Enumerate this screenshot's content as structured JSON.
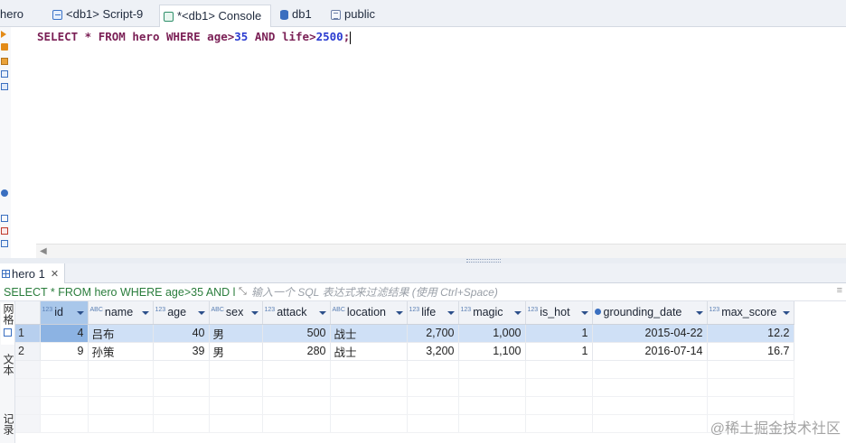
{
  "tabs": [
    {
      "label": "hero",
      "icon": "table-icon"
    },
    {
      "label": "<db1> Script-9",
      "icon": "script-icon"
    },
    {
      "label": "*<db1> Console",
      "icon": "console-icon",
      "active": true
    },
    {
      "label": "db1",
      "icon": "database-icon"
    },
    {
      "label": "public",
      "icon": "schema-icon"
    }
  ],
  "editor": {
    "sql_kw1": "SELECT",
    "sql_p1": " * ",
    "sql_kw2": "FROM",
    "sql_p2": " hero ",
    "sql_kw3": "WHERE",
    "sql_p3": " age>",
    "sql_n1": "35",
    "sql_p4": " ",
    "sql_kw4": "AND",
    "sql_p5": " life>",
    "sql_n2": "2500",
    "sql_p6": ";"
  },
  "results": {
    "tab_label": "hero 1",
    "close_glyph": "✕",
    "query_text": "SELECT * FROM hero WHERE age>35 AND l",
    "filter_placeholder": "输入一个 SQL 表达式来过滤结果 (使用 Ctrl+Space)",
    "side_tabs": [
      "网格",
      "文本",
      "记录"
    ],
    "type_badge_num": "123",
    "type_badge_text": "ABC",
    "columns": [
      "id",
      "name",
      "age",
      "sex",
      "attack",
      "location",
      "life",
      "magic",
      "is_hot",
      "grounding_date",
      "max_score"
    ],
    "rows": [
      {
        "rn": "1",
        "cells": [
          "4",
          "吕布",
          "40",
          "男",
          "500",
          "战士",
          "2,700",
          "1,000",
          "1",
          "2015-04-22",
          "12.2"
        ]
      },
      {
        "rn": "2",
        "cells": [
          "9",
          "孙策",
          "39",
          "男",
          "280",
          "战士",
          "3,200",
          "1,100",
          "1",
          "2016-07-14",
          "16.7"
        ]
      }
    ]
  },
  "watermark": "@稀土掘金技术社区"
}
